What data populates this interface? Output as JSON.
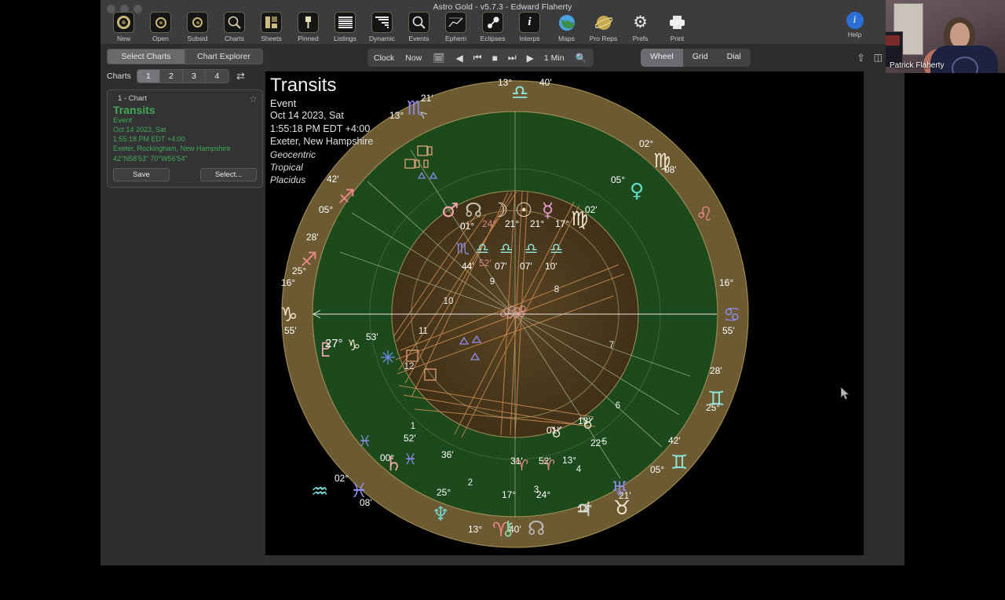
{
  "window": {
    "app_title": "Astro Gold - v5.7.3 - Edward Flaherty"
  },
  "toolbar": {
    "items": [
      {
        "label": "New",
        "icon": "new-chart-icon"
      },
      {
        "label": "Open",
        "icon": "open-folder-icon"
      },
      {
        "label": "Subsid",
        "icon": "subsidiary-charts-icon"
      },
      {
        "label": "Charts",
        "icon": "charts-magnifier-icon"
      },
      {
        "label": "Sheets",
        "icon": "sheets-icon"
      },
      {
        "label": "Pinned",
        "icon": "pin-icon"
      },
      {
        "label": "Listings",
        "icon": "listings-lines-icon"
      },
      {
        "label": "Dynamic",
        "icon": "dynamic-bars-icon"
      },
      {
        "label": "Events",
        "icon": "events-magnifier-icon"
      },
      {
        "label": "Ephem",
        "icon": "ephemeris-graph-icon"
      },
      {
        "label": "Eclipses",
        "icon": "eclipses-icon"
      },
      {
        "label": "Interps",
        "icon": "interpretations-info-icon"
      },
      {
        "label": "Maps",
        "icon": "globe-icon"
      },
      {
        "label": "Pro Reps",
        "icon": "planet-report-icon"
      },
      {
        "label": "Prefs",
        "icon": "gear-icon"
      },
      {
        "label": "Print",
        "icon": "printer-icon"
      }
    ],
    "help": {
      "label": "Help",
      "icon": "info-circle-icon"
    }
  },
  "sidebar": {
    "segmented": [
      {
        "label": "Select Charts",
        "selected": true
      },
      {
        "label": "Chart Explorer",
        "selected": false
      }
    ],
    "charts_caption": "Charts",
    "chart_numbers": [
      "1",
      "2",
      "3",
      "4"
    ],
    "chart_numbers_selected": "1",
    "shuffle_icon": "shuffle-icon",
    "card": {
      "header": "1 - Chart",
      "star_icon": "star-outline-icon",
      "title": "Transits",
      "subtitle": "Event",
      "date": "Oct 14 2023, Sat",
      "time": "1:55:18 PM EDT +4:00",
      "place": "Exeter, Rockingham, New Hampshire",
      "coords": "42°N58'53\" 70°W56'54\"",
      "save_label": "Save",
      "select_label": "Select..."
    }
  },
  "clockbar": {
    "clock_label": "Clock",
    "now_label": "Now",
    "calendar_icon": "calendar-icon",
    "step_back_icon": "step-back-icon",
    "jump_back_icon": "jump-back-icon",
    "stop_icon": "stop-icon",
    "jump_forward_icon": "jump-forward-icon",
    "play_icon": "play-icon",
    "interval": "1 Min",
    "zoom_icon": "search-icon",
    "view_modes": [
      {
        "label": "Wheel",
        "selected": true
      },
      {
        "label": "Grid",
        "selected": false
      },
      {
        "label": "Dial",
        "selected": false
      }
    ],
    "share_icon": "share-icon",
    "sidebar_toggle_icon": "sidebar-toggle-icon"
  },
  "chart": {
    "title": "Transits",
    "subtitle": "Event",
    "date": "Oct 14 2023, Sat",
    "time": "1:55:18 PM EDT +4:00",
    "place": "Exeter, New Hampshire",
    "coord_system": "Geocentric",
    "zodiac": "Tropical",
    "house_system": "Placidus",
    "cursor_icon": "mouse-pointer-icon"
  },
  "chart_data": {
    "type": "wheel",
    "title": "Transits",
    "house_numbers": [
      "1",
      "2",
      "3",
      "4",
      "5",
      "6",
      "7",
      "8",
      "9",
      "10",
      "11",
      "12"
    ],
    "angles": [
      {
        "name": "Ascendant",
        "deg": "16°",
        "sign": "♑",
        "sign_name": "Capricorn",
        "min": "55'",
        "position": "left"
      },
      {
        "name": "Descendant",
        "deg": "16°",
        "sign": "♋",
        "sign_name": "Cancer",
        "min": "55'",
        "position": "right"
      },
      {
        "name": "Midheaven",
        "deg": "13°",
        "sign": "♎",
        "sign_name": "Libra",
        "min": "40'",
        "position": "top"
      },
      {
        "name": "Imum Coeli",
        "deg": "13°",
        "sign": "♈",
        "sign_name": "Aries",
        "min": "40'",
        "position": "bottom"
      }
    ],
    "cusps": [
      {
        "deg": "13°",
        "sign": "♏",
        "sign_name": "Scorpio",
        "min": "21'"
      },
      {
        "deg": "05°",
        "sign": "♐",
        "sign_name": "Sagittarius",
        "min": "42'"
      },
      {
        "deg": "25°",
        "sign": "♐",
        "sign_name": "Sagittarius",
        "min": "28'"
      },
      {
        "deg": "02°",
        "sign": "♒",
        "sign_name": "Aquarius",
        "min": ""
      },
      {
        "deg": "02°",
        "sign": "♓",
        "sign_name": "Pisces",
        "min": "08'"
      },
      {
        "deg": "25°",
        "sign": "♓",
        "sign_name": "Pisces",
        "min": ""
      },
      {
        "deg": "13°",
        "sign": "♉",
        "sign_name": "Taurus",
        "min": ""
      },
      {
        "deg": "25°",
        "sign": "♊",
        "sign_name": "Gemini",
        "min": "05'"
      },
      {
        "deg": "05°",
        "sign": "♊",
        "sign_name": "Gemini",
        "min": "42'"
      },
      {
        "deg": "28°",
        "sign": "♊",
        "sign_name": "Gemini",
        "min": "25°"
      },
      {
        "deg": "02°",
        "sign": "♍",
        "sign_name": "Virgo",
        "min": "08'"
      },
      {
        "deg": "05°",
        "sign": "♍",
        "sign_name": "Virgo",
        "min": "02'"
      },
      {
        "deg": "",
        "sign": "♌",
        "sign_name": "Leo",
        "min": ""
      }
    ],
    "planets": [
      {
        "name": "Mars",
        "glyph": "♂",
        "deg": "01°",
        "sign": "♏",
        "sign_name": "Scorpio",
        "min": "44'",
        "color": "#f0a8a8"
      },
      {
        "name": "NorthNode",
        "glyph": "☊",
        "deg": "24°",
        "sign": "♎",
        "sign_name": "Libra",
        "min": "52'",
        "color": "#c7bfae"
      },
      {
        "name": "Moon",
        "glyph": "☽",
        "deg": "21°",
        "sign": "♎",
        "sign_name": "Libra",
        "min": "07'",
        "color": "#efe2c0"
      },
      {
        "name": "Sun",
        "glyph": "☉",
        "deg": "21°",
        "sign": "♎",
        "sign_name": "Libra",
        "min": "07'",
        "color": "#efe2c0"
      },
      {
        "name": "Mercury",
        "glyph": "☿",
        "deg": "17°",
        "sign": "♎",
        "sign_name": "Libra",
        "min": "10'",
        "color": "#e79ad0"
      },
      {
        "name": "Venus",
        "glyph": "♀",
        "deg": "05°",
        "sign": "♍",
        "sign_name": "Virgo",
        "min": "02'",
        "color": "#63d9c8"
      },
      {
        "name": "Uranus",
        "glyph": "♅",
        "deg": "22°",
        "sign": "♉",
        "sign_name": "Taurus",
        "min": "21'",
        "color": "#8f8ce8"
      },
      {
        "name": "Jupiter",
        "glyph": "♃",
        "deg": "13°",
        "sign": "♉",
        "sign_name": "Taurus",
        "min": "01'",
        "color": "#d8d8d8"
      },
      {
        "name": "Chiron",
        "glyph": "⚷",
        "deg": "17°",
        "sign": "♈",
        "sign_name": "Aries",
        "min": "31'",
        "color": "#8fd2a0"
      },
      {
        "name": "SouthNode",
        "glyph": "☊",
        "deg": "24°",
        "sign": "♈",
        "sign_name": "Aries",
        "min": "52'",
        "color": "#b8b8b8"
      },
      {
        "name": "Neptune",
        "glyph": "♆",
        "deg": "25°",
        "sign": "♓",
        "sign_name": "Pisces",
        "min": "36'",
        "color": "#6fd4cf"
      },
      {
        "name": "Saturn",
        "glyph": "♄",
        "deg": "00°",
        "sign": "♓",
        "sign_name": "Pisces",
        "min": "52'",
        "color": "#eaa5a5"
      },
      {
        "name": "Pluto",
        "glyph": "♇",
        "deg": "27°",
        "sign": "♑",
        "sign_name": "Capricorn",
        "min": "53'",
        "color": "#f0a0b5"
      }
    ],
    "aspect_glyphs": [
      {
        "symbol": "□",
        "name": "square",
        "color": "#e5a27a"
      },
      {
        "symbol": "△",
        "name": "trine",
        "color": "#8f8ce8"
      },
      {
        "symbol": "✳",
        "name": "sextile",
        "color": "#6c8ce8"
      }
    ],
    "colors": {
      "outer_ring": "#6b5a32",
      "sign_ring": "#1d4a1d",
      "inner_disc": "#4a3a1e",
      "background": "#000000",
      "aspect_line": "#c98a5a"
    }
  },
  "video": {
    "name": "Patrick Flaherty"
  }
}
